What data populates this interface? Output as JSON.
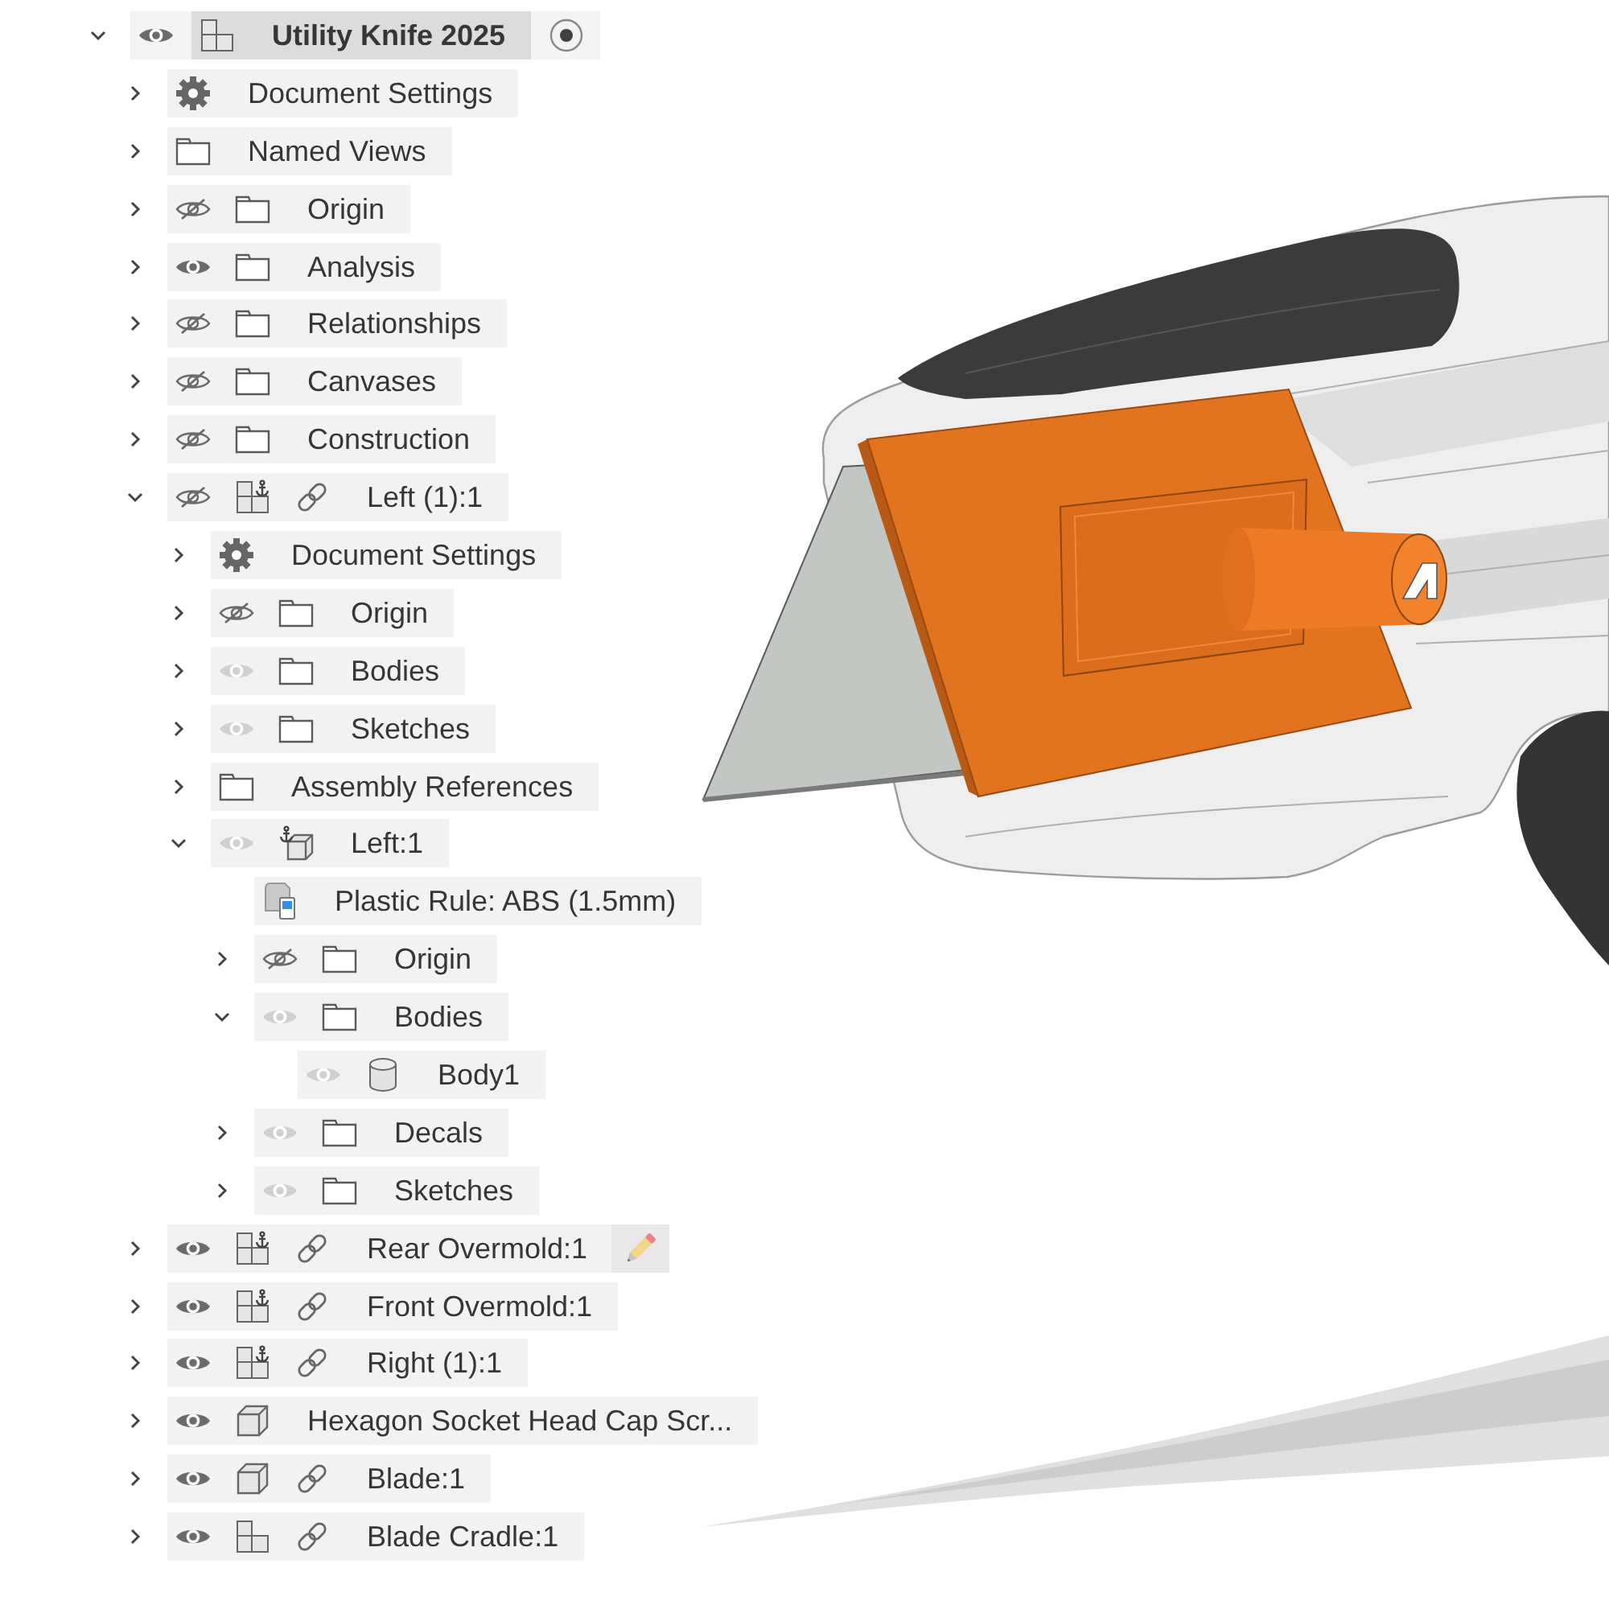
{
  "browser": {
    "tree": [
      {
        "label": "Utility Knife 2025",
        "kind": "assembly",
        "anchored": false,
        "linked": false,
        "visible": true,
        "dimmed": false,
        "expanded": true,
        "active": true,
        "children": [
          {
            "label": "Document Settings",
            "kind": "settings",
            "expanded": false
          },
          {
            "label": "Named Views",
            "kind": "folder",
            "expanded": false
          },
          {
            "label": "Origin",
            "kind": "folder",
            "visible": false,
            "dimmed": false,
            "expanded": false
          },
          {
            "label": "Analysis",
            "kind": "folder",
            "visible": true,
            "dimmed": false,
            "expanded": false
          },
          {
            "label": "Relationships",
            "kind": "folder",
            "visible": false,
            "dimmed": false,
            "expanded": false
          },
          {
            "label": "Canvases",
            "kind": "folder",
            "visible": false,
            "dimmed": false,
            "expanded": false
          },
          {
            "label": "Construction",
            "kind": "folder",
            "visible": false,
            "dimmed": false,
            "expanded": false
          },
          {
            "label": "Left (1):1",
            "kind": "assembly",
            "anchored": true,
            "linked": true,
            "visible": false,
            "dimmed": false,
            "expanded": true,
            "children": [
              {
                "label": "Document Settings",
                "kind": "settings",
                "expanded": false
              },
              {
                "label": "Origin",
                "kind": "folder",
                "visible": false,
                "dimmed": false,
                "expanded": false
              },
              {
                "label": "Bodies",
                "kind": "folder",
                "visible": true,
                "dimmed": true,
                "expanded": false
              },
              {
                "label": "Sketches",
                "kind": "folder",
                "visible": true,
                "dimmed": true,
                "expanded": false
              },
              {
                "label": "Assembly References",
                "kind": "folder",
                "expanded": false
              },
              {
                "label": "Left:1",
                "kind": "part",
                "anchored": true,
                "linked": false,
                "visible": true,
                "dimmed": true,
                "expanded": true,
                "children": [
                  {
                    "label": "Plastic Rule: ABS (1.5mm)",
                    "kind": "material"
                  },
                  {
                    "label": "Origin",
                    "kind": "folder",
                    "visible": false,
                    "dimmed": false,
                    "expanded": false
                  },
                  {
                    "label": "Bodies",
                    "kind": "folder",
                    "visible": true,
                    "dimmed": true,
                    "expanded": true,
                    "children": [
                      {
                        "label": "Body1",
                        "kind": "body",
                        "visible": true,
                        "dimmed": true
                      }
                    ]
                  },
                  {
                    "label": "Decals",
                    "kind": "folder",
                    "visible": true,
                    "dimmed": true,
                    "expanded": false
                  },
                  {
                    "label": "Sketches",
                    "kind": "folder",
                    "visible": true,
                    "dimmed": true,
                    "expanded": false
                  }
                ]
              }
            ]
          },
          {
            "label": "Rear Overmold:1",
            "kind": "assembly",
            "anchored": true,
            "linked": true,
            "visible": true,
            "dimmed": false,
            "expanded": false,
            "editing": true
          },
          {
            "label": "Front Overmold:1",
            "kind": "assembly",
            "anchored": true,
            "linked": true,
            "visible": true,
            "dimmed": false,
            "expanded": false
          },
          {
            "label": "Right (1):1",
            "kind": "assembly",
            "anchored": true,
            "linked": true,
            "visible": true,
            "dimmed": false,
            "expanded": false
          },
          {
            "label": "Hexagon Socket Head Cap Scr...",
            "kind": "part",
            "anchored": false,
            "linked": false,
            "visible": true,
            "dimmed": false,
            "expanded": false
          },
          {
            "label": "Blade:1",
            "kind": "part",
            "anchored": false,
            "linked": true,
            "visible": true,
            "dimmed": false,
            "expanded": false
          },
          {
            "label": "Blade Cradle:1",
            "kind": "assembly",
            "anchored": false,
            "linked": true,
            "visible": true,
            "dimmed": false,
            "expanded": false
          }
        ]
      }
    ]
  }
}
